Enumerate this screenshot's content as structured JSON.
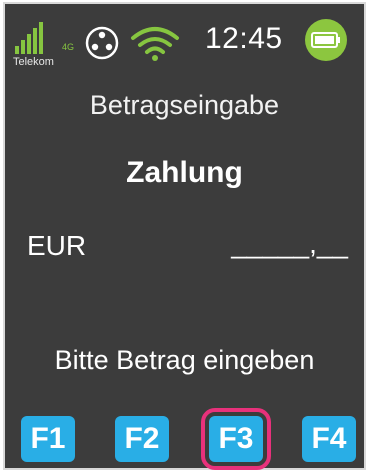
{
  "status_bar": {
    "carrier": "Telekom",
    "network_type": "4G",
    "sim_icon": "sim-card-icon",
    "wifi_icon": "wifi-icon",
    "time": "12:45",
    "battery_icon": "battery-full-icon"
  },
  "screen": {
    "title": "Betragseingabe",
    "subtitle": "Zahlung",
    "currency": "EUR",
    "amount_placeholder": "_____,__",
    "prompt": "Bitte Betrag eingeben"
  },
  "function_keys": [
    {
      "label": "F1",
      "selected": false
    },
    {
      "label": "F2",
      "selected": false
    },
    {
      "label": "F3",
      "selected": true
    },
    {
      "label": "F4",
      "selected": false
    }
  ],
  "colors": {
    "screen_background": "#3c3c3c",
    "key_blue": "#29aee6",
    "highlight_pink": "#e8317b",
    "status_green": "#8cc63f"
  }
}
